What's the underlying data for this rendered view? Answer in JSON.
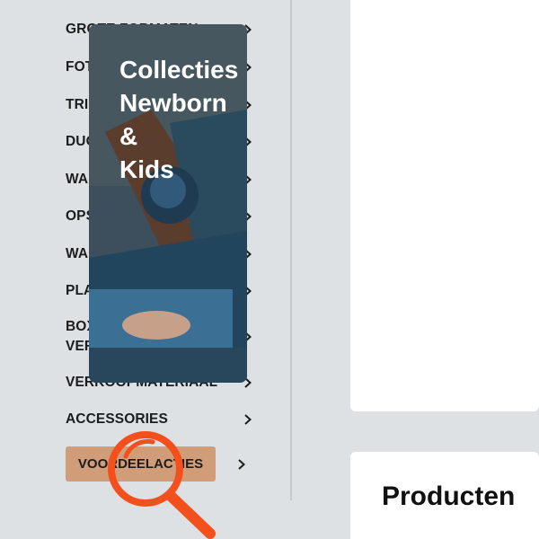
{
  "sidebar": {
    "items": [
      {
        "label": "GROTE FORMATEN",
        "icon": "chevron-right-icon"
      },
      {
        "label": "FOTO KAARTEN",
        "icon": "chevron-right-icon"
      },
      {
        "label": "TRIPLEX",
        "icon": "chevron-right-icon"
      },
      {
        "label": "DUO LITE",
        "icon": "chevron-right-icon"
      },
      {
        "label": "WANDDECORATIES",
        "icon": "chevron-right-icon"
      },
      {
        "label": "OPSLAGMEDIUM",
        "icon": "chevron-right-icon"
      },
      {
        "label": "WANDKALENDERS",
        "icon": "chevron-right-icon"
      },
      {
        "label": "PLAK ALBUM",
        "icon": "chevron-right-icon"
      },
      {
        "label_line1": "BOXEN &",
        "label_line2": "VERPAKKINGEN",
        "icon": "chevron-right-icon"
      },
      {
        "label": "VERKOOPMATERIAAL",
        "icon": "chevron-right-icon"
      },
      {
        "label": "ACCESSORIES",
        "icon": "chevron-right-icon"
      }
    ],
    "promo": {
      "label": "VOORDEELACTIES",
      "icon": "chevron-right-icon",
      "color": "#d19c78"
    }
  },
  "hero": {
    "title_line1": "Collecties",
    "title_line2": "Newborn",
    "title_line3": "&",
    "title_line4": "Kids"
  },
  "products": {
    "title": "Producten"
  },
  "overlay": {
    "icon": "magnifier-icon",
    "color": "#f4501e"
  },
  "colors": {
    "background": "#dde1e3",
    "card": "#ffffff",
    "text": "#1c1c1c"
  }
}
